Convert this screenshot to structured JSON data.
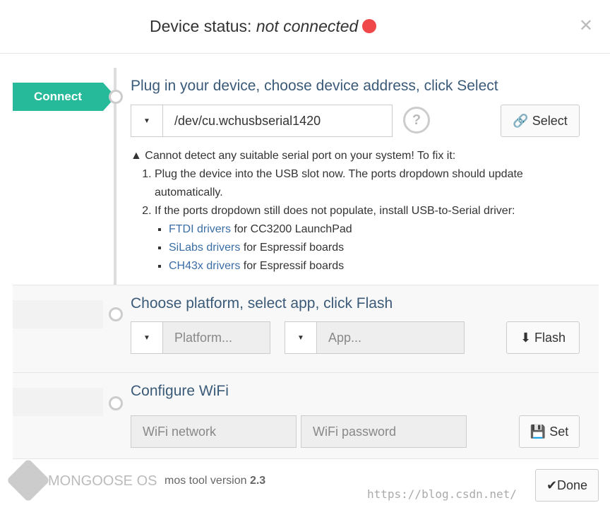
{
  "header": {
    "title_prefix": "Device status: ",
    "status": "not connected",
    "status_color": "#f0474b",
    "close_icon": "close-icon"
  },
  "steps": [
    {
      "label": "Connect",
      "heading": "Plug in your device, choose device address, click Select",
      "port_value": "/dev/cu.wchusbserial1420",
      "button": "Select"
    },
    {
      "label": "",
      "heading": "Choose platform, select app, click Flash",
      "platform_placeholder": "Platform...",
      "app_placeholder": "App...",
      "button": "Flash"
    },
    {
      "label": "",
      "heading": "Configure WiFi",
      "network_placeholder": "WiFi network",
      "password_placeholder": "WiFi password",
      "button": "Set"
    }
  ],
  "warning": {
    "text": "Cannot detect any suitable serial port on your system! To fix it:",
    "steps": [
      "Plug the device into the USB slot now. The ports dropdown should update automatically.",
      "If the ports dropdown still does not populate, install USB-to-Serial driver:"
    ],
    "drivers": [
      {
        "link": "FTDI drivers",
        "rest": " for CC3200 LaunchPad"
      },
      {
        "link": "SiLabs drivers",
        "rest": " for Espressif boards"
      },
      {
        "link": "CH43x drivers",
        "rest": " for Espressif boards"
      }
    ]
  },
  "footer": {
    "brand": "MONGOOSE OS",
    "version_label": "mos tool version ",
    "version": "2.3",
    "done": "Done",
    "watermark": "https://blog.csdn.net/"
  },
  "accent": "#26b99a"
}
